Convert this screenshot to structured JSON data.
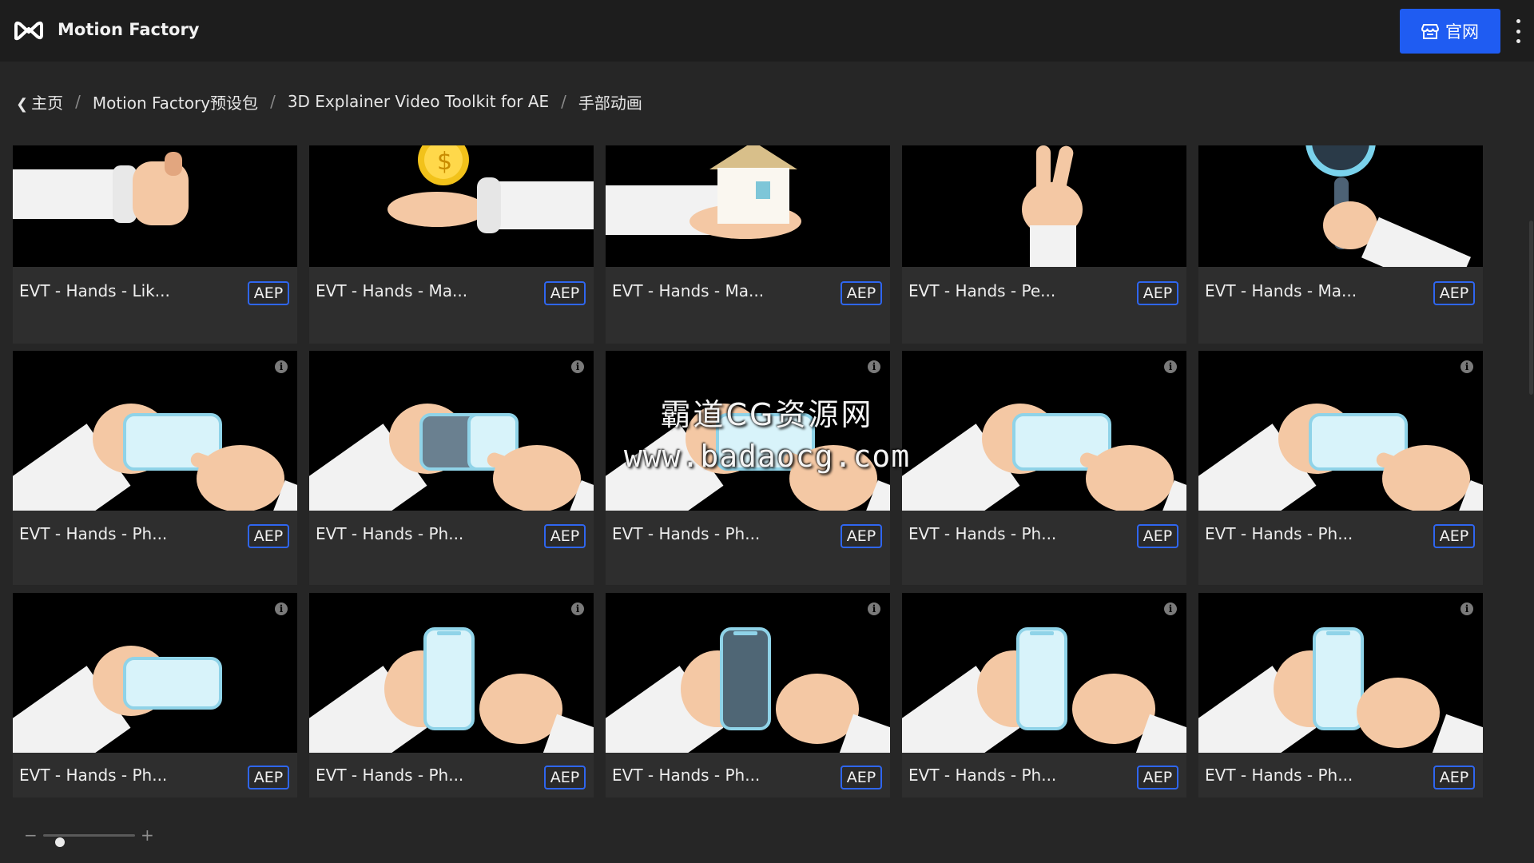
{
  "app": {
    "title": "Motion Factory"
  },
  "header": {
    "official_label": "官网",
    "official_icon": "store-icon",
    "menu_icon": "kebab-menu-icon"
  },
  "breadcrumb": {
    "items": [
      "主页",
      "Motion Factory预设包",
      "3D Explainer Video Toolkit for AE",
      "手部动画"
    ],
    "separator": "/"
  },
  "badge_label": "AEP",
  "grid": {
    "rows": [
      [
        {
          "title": "EVT - Hands - Lik...",
          "art": "like"
        },
        {
          "title": "EVT - Hands - Ma...",
          "art": "coin"
        },
        {
          "title": "EVT - Hands - Ma...",
          "art": "house"
        },
        {
          "title": "EVT - Hands - Pe...",
          "art": "peace"
        },
        {
          "title": "EVT - Hands - Ma...",
          "art": "magnifier"
        }
      ],
      [
        {
          "title": "EVT - Hands - Ph...",
          "art": "phone-h"
        },
        {
          "title": "EVT - Hands - Ph...",
          "art": "phone-h-dark"
        },
        {
          "title": "EVT - Hands - Ph...",
          "art": "phone-h"
        },
        {
          "title": "EVT - Hands - Ph...",
          "art": "phone-h"
        },
        {
          "title": "EVT - Hands - Ph...",
          "art": "phone-h"
        }
      ],
      [
        {
          "title": "EVT - Hands - Ph...",
          "art": "phone-h-only"
        },
        {
          "title": "EVT - Hands - Ph...",
          "art": "phone-v"
        },
        {
          "title": "EVT - Hands - Ph...",
          "art": "phone-v-dark"
        },
        {
          "title": "EVT - Hands - Ph...",
          "art": "phone-v"
        },
        {
          "title": "EVT - Hands - Ph...",
          "art": "phone-v-tap"
        }
      ]
    ]
  },
  "watermark": {
    "line1": "霸道CG资源网",
    "line2": "www.badaocg.com"
  },
  "zoom": {
    "minus": "−",
    "plus": "+",
    "level": 0.18
  },
  "colors": {
    "accent": "#1f5cf2",
    "badge_border": "#2f66f0",
    "background": "#262626",
    "topbar": "#1d1d1d"
  }
}
